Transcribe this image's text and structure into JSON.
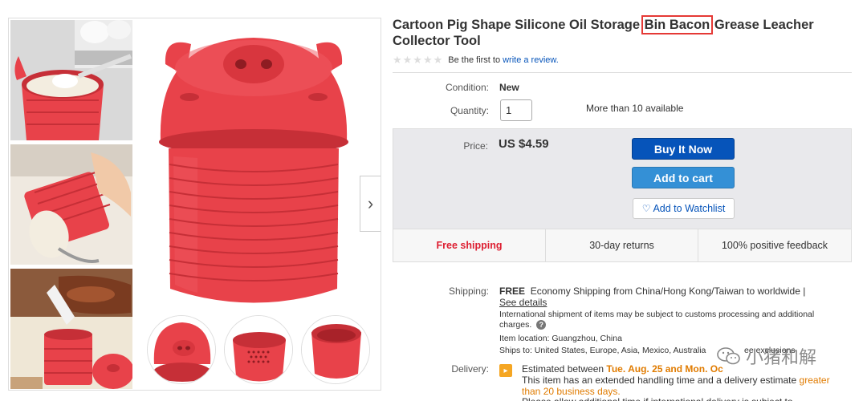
{
  "listing": {
    "title_part1": "Cartoon Pig Shape Silicone Oil Storage",
    "title_highlight": "Bin Bacon",
    "title_part2": "Grease Leacher Collector Tool",
    "rating_stars": "★★★★★",
    "rating_prefix": "Be the first to",
    "rating_link": "write a review."
  },
  "details": {
    "condition_label": "Condition:",
    "condition_value": "New",
    "quantity_label": "Quantity:",
    "quantity_value": "1",
    "availability": "More than 10 available"
  },
  "buybox": {
    "price_label": "Price:",
    "price_value": "US $4.59",
    "buy_now_label": "Buy It Now",
    "add_to_cart_label": "Add to cart",
    "watchlist_label": "Add to Watchlist",
    "features": [
      "Free shipping",
      "30-day returns",
      "100% positive feedback"
    ]
  },
  "shipping": {
    "label": "Shipping:",
    "free": "FREE",
    "method": "Economy Shipping from China/Hong Kong/Taiwan to worldwide |",
    "see_details": "See details",
    "customs_note": "International shipment of items may be subject to customs processing and additional charges.",
    "item_location": "Item location:  Guangzhou, China",
    "ships_to": "Ships to:  United States, Europe, Asia, Mexico, Australia",
    "ships_to_tail": "ee exclusions"
  },
  "delivery": {
    "label": "Delivery:",
    "estimated_prefix": "Estimated between",
    "estimated_dates": "Tue. Aug. 25 and Mon. Oc",
    "handling_prefix": "This item has an extended handling time and a delivery estimate",
    "handling_highlight": "greater than 20 business days.",
    "extra": "Please allow additional time if international delivery is subject to"
  },
  "watermark": {
    "text": "小猪和解"
  },
  "colors": {
    "ebay_blue": "#0654ba",
    "cart_blue": "#3490d6",
    "free_shipping_red": "#dd1e31",
    "product_red": "#e8424a",
    "highlight_box": "#e53935"
  }
}
